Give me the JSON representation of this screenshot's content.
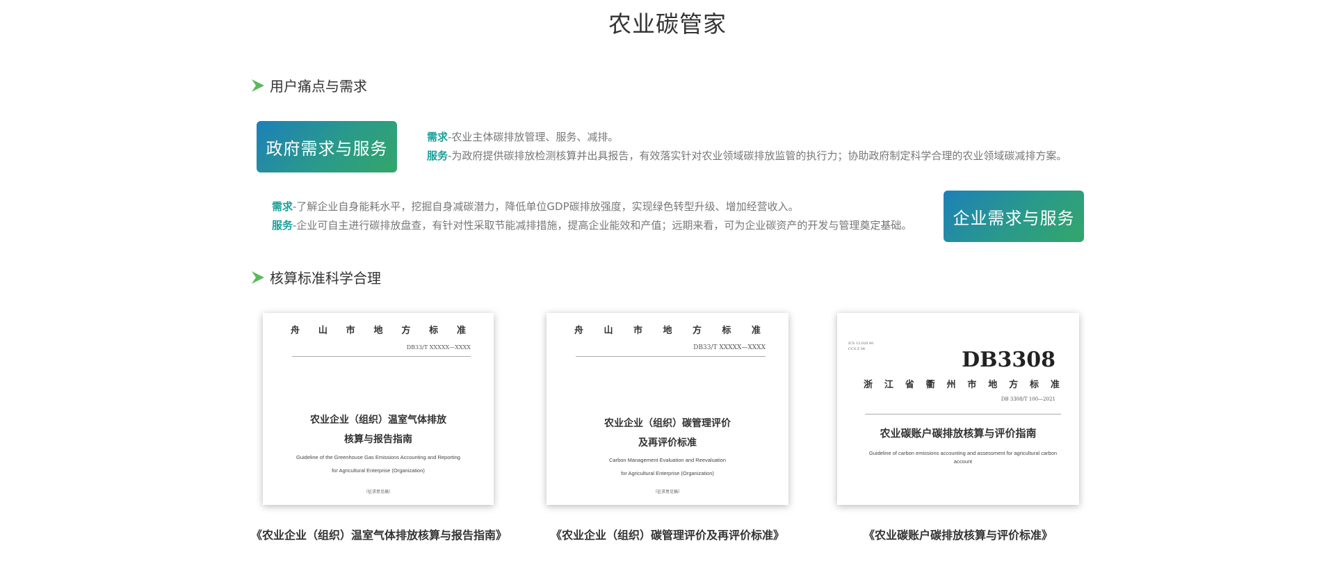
{
  "page_title": "农业碳管家",
  "section1": {
    "heading": "用户痛点与需求",
    "icon": "green-arrow-icon"
  },
  "section2": {
    "heading": "核算标准科学合理",
    "icon": "green-arrow-icon"
  },
  "gov": {
    "label": "政府需求与服务",
    "need_kw": "需求",
    "need_text": "-农业主体碳排放管理、服务、减排。",
    "service_kw": "服务",
    "service_text": "-为政府提供碳排放检测核算并出具报告，有效落实针对农业领域碳排放监管的执行力；协助政府制定科学合理的农业领域碳减排方案。"
  },
  "ent": {
    "label": "企业需求与服务",
    "need_kw": "需求",
    "need_text": "-了解企业自身能耗水平，挖掘自身减碳潜力，降低单位GDP碳排放强度，实现绿色转型升级、增加经营收入。",
    "service_kw": "服务",
    "service_text": "-企业可自主进行碳排放盘查，有针对性采取节能减排措施，提高企业能效和产值；远期来看，可为企业碳资产的开发与管理奠定基础。"
  },
  "docs": [
    {
      "head_chars": [
        "舟",
        "山",
        "市",
        "地",
        "方",
        "标",
        "准"
      ],
      "code": "DB33/T XXXXX—XXXX",
      "title_cn_1": "农业企业（组织）温室气体排放",
      "title_cn_2": "核算与报告指南",
      "title_en_1": "Guideline of the Greenhouse Gas Emissions Accounting and Reporting",
      "title_en_2": "for Agricultural Enterprise (Organization)",
      "note": "（征求意见稿）",
      "caption": "《农业企业（组织）温室气体排放核算与报告指南》"
    },
    {
      "head_chars": [
        "舟",
        "山",
        "市",
        "地",
        "方",
        "标",
        "准"
      ],
      "code": "DB33/T XXXXX—XXXX",
      "title_cn_1": "农业企业（组织）碳管理评价",
      "title_cn_2": "及再评价标准",
      "title_en_1": "Carbon Management Evaluation and Reevaluation",
      "title_en_2": "for Agricultural Enterprise (Organization)",
      "note": "（征求意见稿）",
      "caption": "《农业企业（组织）碳管理评价及再评价标准》"
    },
    {
      "meta_1": "ICS 13.020.40",
      "meta_2": "CCS Z 04",
      "big": "DB3308",
      "head_chars": [
        "浙",
        "江",
        "省",
        "衢",
        "州",
        "市",
        "地",
        "方",
        "标",
        "准"
      ],
      "code": "DB 3308/T 100—2021",
      "title_cn": "农业碳账户碳排放核算与评价指南",
      "title_en": "Guideline of carbon emissions accounting and assessment for agricultural carbon account",
      "caption": "《农业碳账户碳排放核算与评价标准》"
    }
  ],
  "colors": {
    "accent_teal": "#1aa09a",
    "gradient_start": "#1d80b8",
    "gradient_end": "#33a66a",
    "arrow_green": "#5cb85c"
  }
}
